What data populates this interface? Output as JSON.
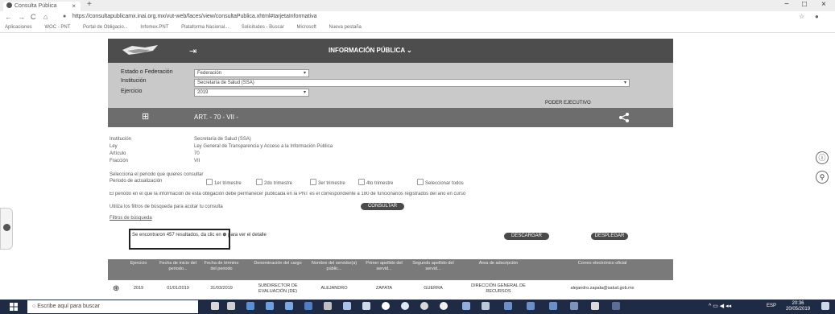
{
  "browser": {
    "tab_title": "Consulta Pública",
    "tab_close": "×",
    "new_tab": "+",
    "url": "https://consultapublicamx.inai.org.mx/vut-web/faces/view/consultaPublica.xhtml#tarjetaInformativa",
    "nav_back": "←",
    "nav_forward": "→",
    "nav_reload": "C",
    "nav_home": "⌂",
    "win_minimize": "−",
    "win_maximize": "□",
    "win_close": "×",
    "bookmarks": [
      "Aplicaciones",
      "WOC - PNT",
      "Portal de Obligacio...",
      "Infomex.PNT",
      "Plataforma Nacional...",
      "Solicitudes - Buscar",
      "Microsoft",
      "Nueva pestaña"
    ]
  },
  "header": {
    "title": "INFORMACIÓN PÚBLICA",
    "title_caret": "⌄",
    "home_icon": "⇥"
  },
  "filters": {
    "estado_label": "Estado o Federación",
    "estado_value": "Federación",
    "institucion_label": "Institución",
    "institucion_value": "Secretaría de Salud (SSA)",
    "ejercicio_label": "Ejercicio",
    "ejercicio_value": "2019",
    "caret": "▾",
    "poder": "PODER EJECUTIVO"
  },
  "article": {
    "title": "ART. - 70 - VII -",
    "tag_icon": "⊞",
    "share_icon": "share-icon"
  },
  "details": {
    "rows": [
      {
        "label": "Institución",
        "value": "Secretaría de Salud (SSA)"
      },
      {
        "label": "Ley",
        "value": "Ley General de Transparencia y Acceso a la Información Pública"
      },
      {
        "label": "Artículo",
        "value": "70"
      },
      {
        "label": "Fracción",
        "value": "VII"
      }
    ],
    "periodo_label": "Selecciona el periodo que quieres consultar",
    "periodo_sub": "Periodo de actualización",
    "checks": [
      "1er trimestre",
      "2do trimestre",
      "3er trimestre",
      "4to trimestre",
      "Seleccionar todos"
    ],
    "note": "El periodo en el que la información de esta obligación debe permanecer publicada en la PNT es el correspondiente a 180 de funcionarios registrados del año en curso",
    "filtros_text": "Utiliza los filtros de búsqueda para acotar tu consulta",
    "consultar": "CONSULTAR",
    "filtros_link": "Filtros de búsqueda",
    "results": "Se encontraron 457 resultados, da clic en",
    "results_tail": "para ver el detalle",
    "results_icon": "⊕",
    "descargar": "DESCARGAR",
    "desplegar": "DESPLEGAR"
  },
  "table": {
    "headers": [
      "Ejercicio",
      "Fecha de inicio del periodo...",
      "Fecha de término del periodo",
      "Denominación del cargo",
      "Nombre del servidor(a) públic...",
      "Primer apellido del servid...",
      "Segundo apellido del servid...",
      "Área de adscripción",
      "Correo electrónico oficial"
    ],
    "row": [
      "2019",
      "01/01/2019",
      "31/03/2019",
      "SUBDIRECTOR DE EVALUACIÓN (DE)",
      "ALEJANDRO",
      "ZAPATA",
      "GUERRA",
      "DIRECCIÓN GENERAL DE RECURSOS",
      "alejandro.zapata@salud.gob.mx"
    ],
    "row_icon": "⊕"
  },
  "float": {
    "a11y_icon": "info-icon",
    "a11y_glyph": "ⓘ",
    "lowvision_glyph": "⚲"
  },
  "taskbar": {
    "search_placeholder": "Escribe aquí para buscar",
    "time": "20:36",
    "date": "20/05/2019",
    "lang": "ESP"
  }
}
